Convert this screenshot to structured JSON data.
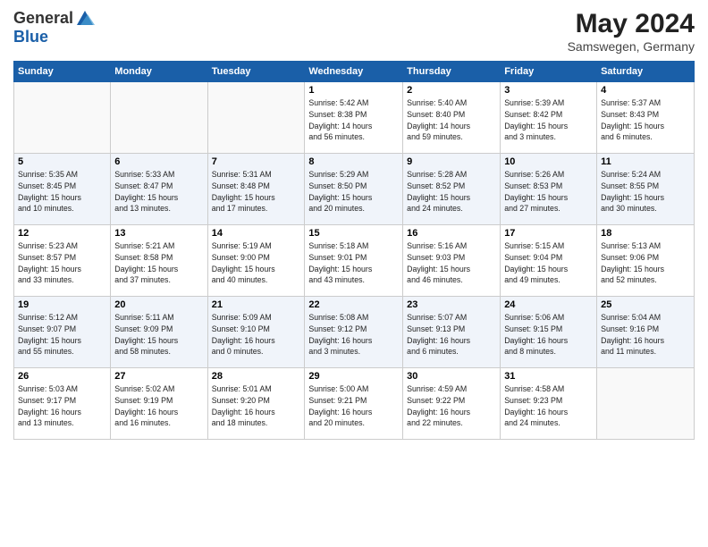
{
  "header": {
    "logo_line1": "General",
    "logo_line2": "Blue",
    "month_year": "May 2024",
    "location": "Samswegen, Germany"
  },
  "days_of_week": [
    "Sunday",
    "Monday",
    "Tuesday",
    "Wednesday",
    "Thursday",
    "Friday",
    "Saturday"
  ],
  "weeks": [
    [
      {
        "day": "",
        "info": ""
      },
      {
        "day": "",
        "info": ""
      },
      {
        "day": "",
        "info": ""
      },
      {
        "day": "1",
        "info": "Sunrise: 5:42 AM\nSunset: 8:38 PM\nDaylight: 14 hours\nand 56 minutes."
      },
      {
        "day": "2",
        "info": "Sunrise: 5:40 AM\nSunset: 8:40 PM\nDaylight: 14 hours\nand 59 minutes."
      },
      {
        "day": "3",
        "info": "Sunrise: 5:39 AM\nSunset: 8:42 PM\nDaylight: 15 hours\nand 3 minutes."
      },
      {
        "day": "4",
        "info": "Sunrise: 5:37 AM\nSunset: 8:43 PM\nDaylight: 15 hours\nand 6 minutes."
      }
    ],
    [
      {
        "day": "5",
        "info": "Sunrise: 5:35 AM\nSunset: 8:45 PM\nDaylight: 15 hours\nand 10 minutes."
      },
      {
        "day": "6",
        "info": "Sunrise: 5:33 AM\nSunset: 8:47 PM\nDaylight: 15 hours\nand 13 minutes."
      },
      {
        "day": "7",
        "info": "Sunrise: 5:31 AM\nSunset: 8:48 PM\nDaylight: 15 hours\nand 17 minutes."
      },
      {
        "day": "8",
        "info": "Sunrise: 5:29 AM\nSunset: 8:50 PM\nDaylight: 15 hours\nand 20 minutes."
      },
      {
        "day": "9",
        "info": "Sunrise: 5:28 AM\nSunset: 8:52 PM\nDaylight: 15 hours\nand 24 minutes."
      },
      {
        "day": "10",
        "info": "Sunrise: 5:26 AM\nSunset: 8:53 PM\nDaylight: 15 hours\nand 27 minutes."
      },
      {
        "day": "11",
        "info": "Sunrise: 5:24 AM\nSunset: 8:55 PM\nDaylight: 15 hours\nand 30 minutes."
      }
    ],
    [
      {
        "day": "12",
        "info": "Sunrise: 5:23 AM\nSunset: 8:57 PM\nDaylight: 15 hours\nand 33 minutes."
      },
      {
        "day": "13",
        "info": "Sunrise: 5:21 AM\nSunset: 8:58 PM\nDaylight: 15 hours\nand 37 minutes."
      },
      {
        "day": "14",
        "info": "Sunrise: 5:19 AM\nSunset: 9:00 PM\nDaylight: 15 hours\nand 40 minutes."
      },
      {
        "day": "15",
        "info": "Sunrise: 5:18 AM\nSunset: 9:01 PM\nDaylight: 15 hours\nand 43 minutes."
      },
      {
        "day": "16",
        "info": "Sunrise: 5:16 AM\nSunset: 9:03 PM\nDaylight: 15 hours\nand 46 minutes."
      },
      {
        "day": "17",
        "info": "Sunrise: 5:15 AM\nSunset: 9:04 PM\nDaylight: 15 hours\nand 49 minutes."
      },
      {
        "day": "18",
        "info": "Sunrise: 5:13 AM\nSunset: 9:06 PM\nDaylight: 15 hours\nand 52 minutes."
      }
    ],
    [
      {
        "day": "19",
        "info": "Sunrise: 5:12 AM\nSunset: 9:07 PM\nDaylight: 15 hours\nand 55 minutes."
      },
      {
        "day": "20",
        "info": "Sunrise: 5:11 AM\nSunset: 9:09 PM\nDaylight: 15 hours\nand 58 minutes."
      },
      {
        "day": "21",
        "info": "Sunrise: 5:09 AM\nSunset: 9:10 PM\nDaylight: 16 hours\nand 0 minutes."
      },
      {
        "day": "22",
        "info": "Sunrise: 5:08 AM\nSunset: 9:12 PM\nDaylight: 16 hours\nand 3 minutes."
      },
      {
        "day": "23",
        "info": "Sunrise: 5:07 AM\nSunset: 9:13 PM\nDaylight: 16 hours\nand 6 minutes."
      },
      {
        "day": "24",
        "info": "Sunrise: 5:06 AM\nSunset: 9:15 PM\nDaylight: 16 hours\nand 8 minutes."
      },
      {
        "day": "25",
        "info": "Sunrise: 5:04 AM\nSunset: 9:16 PM\nDaylight: 16 hours\nand 11 minutes."
      }
    ],
    [
      {
        "day": "26",
        "info": "Sunrise: 5:03 AM\nSunset: 9:17 PM\nDaylight: 16 hours\nand 13 minutes."
      },
      {
        "day": "27",
        "info": "Sunrise: 5:02 AM\nSunset: 9:19 PM\nDaylight: 16 hours\nand 16 minutes."
      },
      {
        "day": "28",
        "info": "Sunrise: 5:01 AM\nSunset: 9:20 PM\nDaylight: 16 hours\nand 18 minutes."
      },
      {
        "day": "29",
        "info": "Sunrise: 5:00 AM\nSunset: 9:21 PM\nDaylight: 16 hours\nand 20 minutes."
      },
      {
        "day": "30",
        "info": "Sunrise: 4:59 AM\nSunset: 9:22 PM\nDaylight: 16 hours\nand 22 minutes."
      },
      {
        "day": "31",
        "info": "Sunrise: 4:58 AM\nSunset: 9:23 PM\nDaylight: 16 hours\nand 24 minutes."
      },
      {
        "day": "",
        "info": ""
      }
    ]
  ]
}
